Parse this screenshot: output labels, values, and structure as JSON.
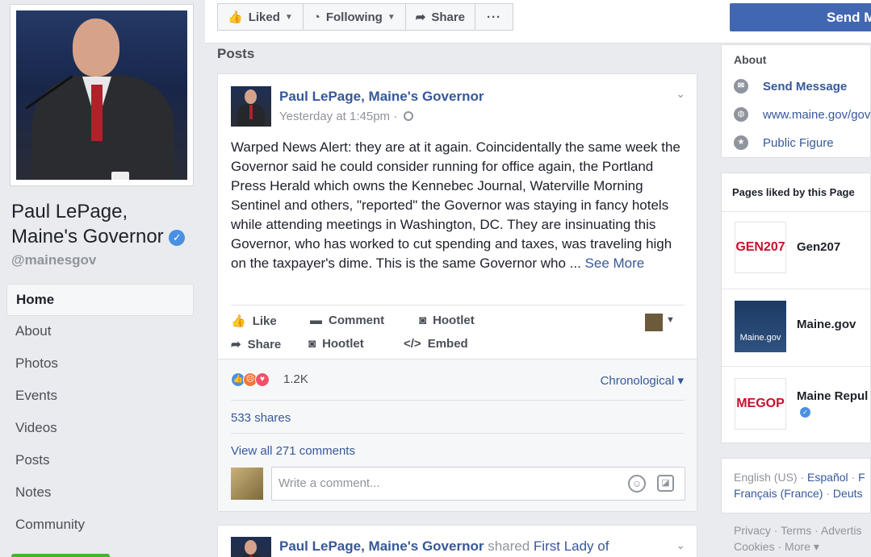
{
  "page": {
    "name": "Paul LePage, Maine's Governor",
    "handle": "@mainesgov"
  },
  "nav": {
    "items": [
      {
        "label": "Home",
        "active": true
      },
      {
        "label": "About"
      },
      {
        "label": "Photos"
      },
      {
        "label": "Events"
      },
      {
        "label": "Videos"
      },
      {
        "label": "Posts"
      },
      {
        "label": "Notes"
      },
      {
        "label": "Community"
      }
    ]
  },
  "topbar": {
    "liked_label": "Liked",
    "following_label": "Following",
    "share_label": "Share",
    "more_label": "···",
    "send_label": "Send M"
  },
  "main": {
    "heading": "Posts",
    "post": {
      "author": "Paul LePage, Maine's Governor",
      "time": "Yesterday at 1:45pm · ",
      "text": "Warped News Alert: they are at it again. Coincidentally the same week the Governor said he could consider running for office again, the Portland Press Herald which owns the Kennebec Journal, Waterville Morning Sentinel and others, \"reported\" the Governor was staying in fancy hotels while attending meetings in Washington, DC. They are insinuating this Governor, who has worked to cut spending and taxes, was traveling high on the taxpayer's dime. This is the same Governor who ... ",
      "see_more": "See More",
      "actions": {
        "like": "Like",
        "comment": "Comment",
        "hootlet1": "Hootlet",
        "share": "Share",
        "hootlet2": "Hootlet",
        "embed": "Embed"
      },
      "reactions_count": "1.2K",
      "sort_label": "Chronological",
      "shares": "533 shares",
      "view_comments": "View all 271 comments",
      "comment_placeholder": "Write a comment..."
    },
    "post2": {
      "author": "Paul LePage, Maine's Governor",
      "shared_text": "shared",
      "shared_target": "First Lady of"
    }
  },
  "sidebar": {
    "about_title": "About",
    "send_message": "Send Message",
    "website": "www.maine.gov/gove",
    "category": "Public Figure",
    "liked_title": "Pages liked by this Page",
    "liked_pages": [
      {
        "name": "Gen207",
        "logo_text": "GEN207"
      },
      {
        "name": "Maine.gov",
        "logo_text": "Maine.gov"
      },
      {
        "name": "Maine Repul",
        "logo_text": "MEGOP"
      }
    ],
    "languages_line1": [
      "English (US)",
      "Español",
      "F"
    ],
    "languages_line2": [
      "Français (France)",
      "Deuts"
    ],
    "footer_line1": [
      "Privacy",
      "Terms",
      "Advertis"
    ],
    "footer_line2": [
      "Cookies",
      "More ▾"
    ]
  },
  "colors": {
    "brand": "#4267b2",
    "link": "#365899",
    "background": "#e9ebee"
  }
}
